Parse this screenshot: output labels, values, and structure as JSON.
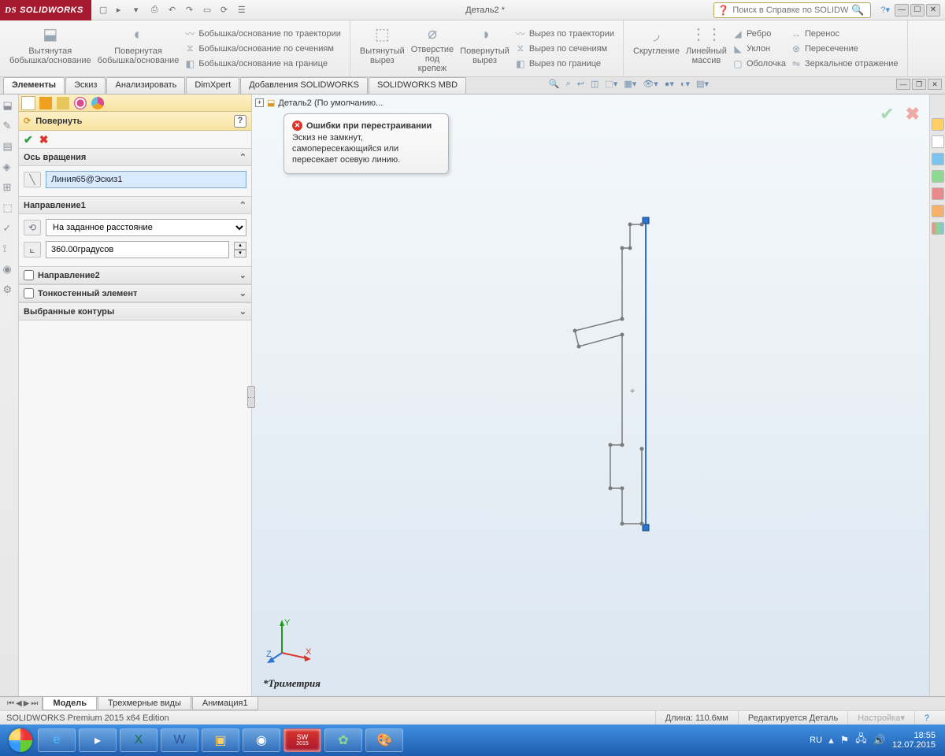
{
  "app_name": "SOLIDWORKS",
  "document_title": "Деталь2 *",
  "search_placeholder": "Поиск в Справке по SOLIDWORKS",
  "ribbon": {
    "extruded_boss": "Вытянутая\nбобышка/основание",
    "revolved_boss": "Повернутая\nбобышка/основание",
    "swept_boss": "Бобышка/основание по траектории",
    "lofted_boss": "Бобышка/основание по сечениям",
    "boundary_boss": "Бобышка/основание на границе",
    "extruded_cut": "Вытянутый\nвырез",
    "hole_wizard": "Отверстие\nпод\nкрепеж",
    "revolved_cut": "Повернутый\nвырез",
    "swept_cut": "Вырез по траектории",
    "lofted_cut": "Вырез по сечениям",
    "boundary_cut": "Вырез по границе",
    "fillet": "Скругление",
    "linear_pattern": "Линейный\nмассив",
    "rib": "Ребро",
    "draft": "Уклон",
    "shell": "Оболочка",
    "move": "Перенос",
    "intersect": "Пересечение",
    "mirror": "Зеркальное отражение"
  },
  "cmd_tabs": [
    "Элементы",
    "Эскиз",
    "Анализировать",
    "DimXpert",
    "Добавления SOLIDWORKS",
    "SOLIDWORKS MBD"
  ],
  "tree_root": "Деталь2  (По умолчанию...",
  "pm": {
    "title": "Повернуть",
    "axis_section": "Ось вращения",
    "axis_value": "Линия65@Эскиз1",
    "dir1_section": "Направление1",
    "dir1_type": "На заданное расстояние",
    "angle_value": "360.00градусов",
    "dir2_section": "Направление2",
    "thin_section": "Тонкостенный элемент",
    "contours_section": "Выбранные контуры"
  },
  "error": {
    "title": "Ошибки при перестраивании",
    "message": "Эскиз не замкнут, самопересекающийся  или пересекает осевую линию."
  },
  "view_label": "*Триметрия",
  "bottom_tabs": [
    "Модель",
    "Трехмерные виды",
    "Анимация1"
  ],
  "status": {
    "edition": "SOLIDWORKS Premium 2015 x64 Edition",
    "length": "Длина: 110.6мм",
    "editing": "Редактируется Деталь",
    "custom": "Настройка"
  },
  "tray": {
    "lang": "RU",
    "time": "18:55",
    "date": "12.07.2015"
  }
}
